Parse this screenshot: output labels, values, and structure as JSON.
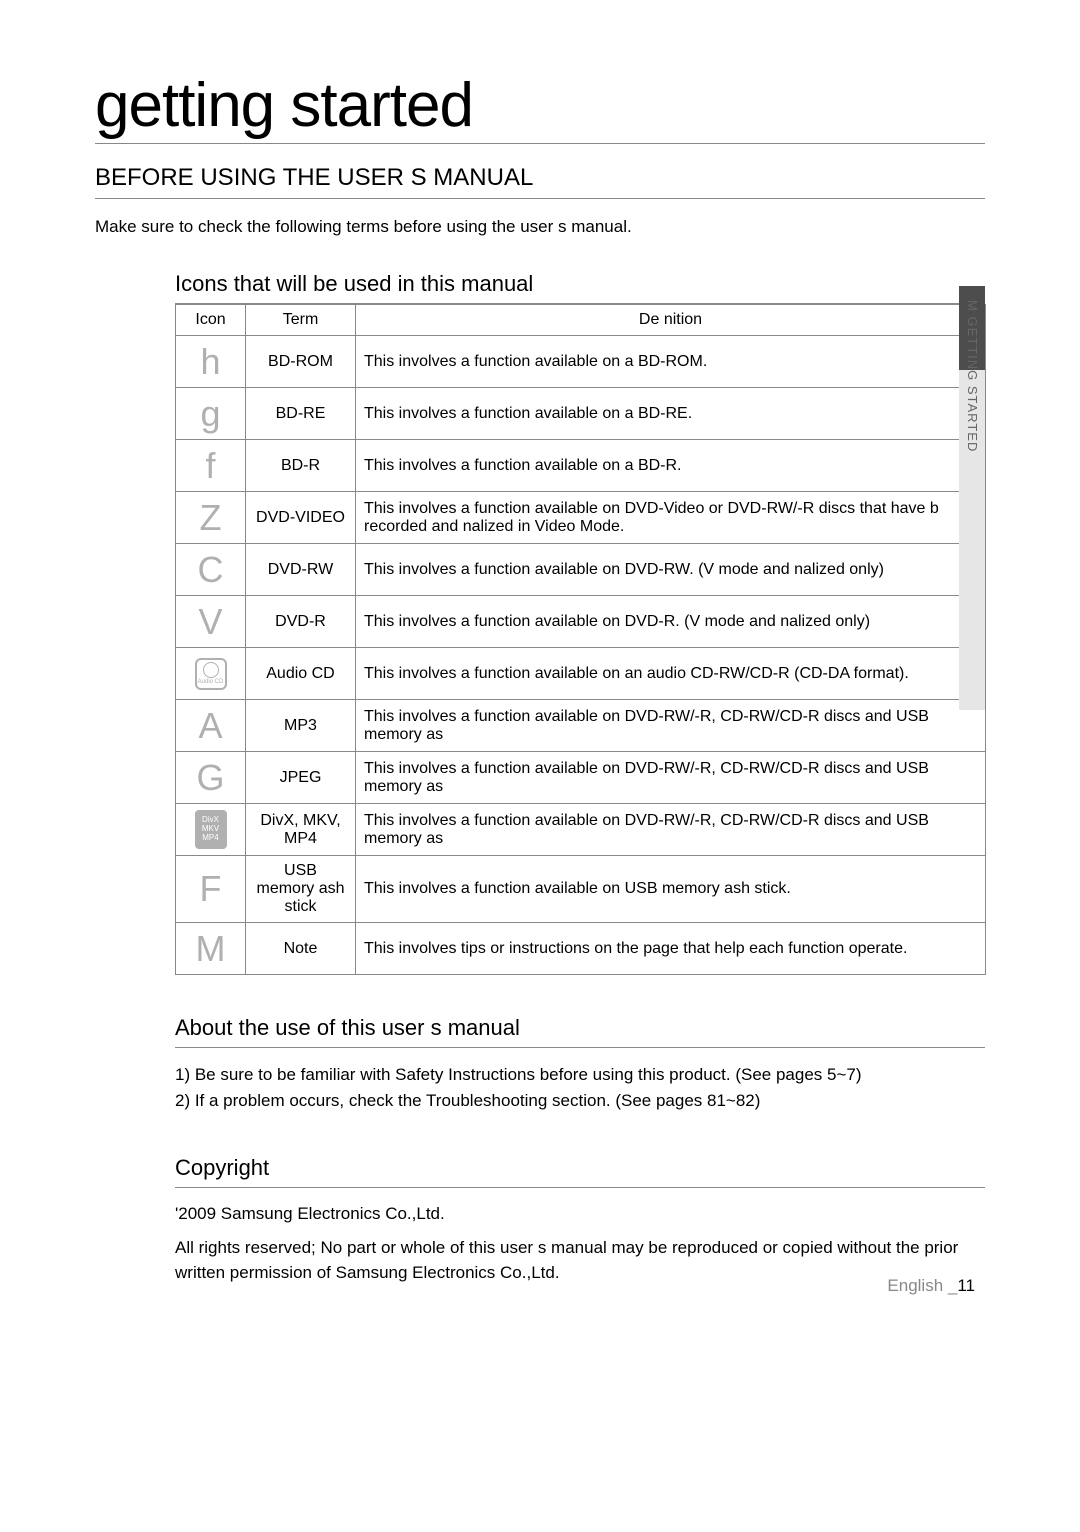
{
  "title": "getting started",
  "sectionTitle": "BEFORE USING THE USER S MANUAL",
  "intro": "Make sure to check the following terms before using the user s manual.",
  "iconsHeading": "Icons that will be used in this manual",
  "tableHeaders": {
    "icon": "Icon",
    "term": "Term",
    "definition": "De nition"
  },
  "rows": [
    {
      "glyph": "h",
      "term": "BD-ROM",
      "def": "This involves a function available on a BD-ROM."
    },
    {
      "glyph": "g",
      "term": "BD-RE",
      "def": "This involves a function available on a BD-RE."
    },
    {
      "glyph": "f",
      "term": "BD-R",
      "def": "This involves a function available on a BD-R."
    },
    {
      "glyph": "Z",
      "term": "DVD-VIDEO",
      "def": "This involves a function available on DVD-Video or DVD-RW/-R discs that have b recorded and  nalized in Video Mode."
    },
    {
      "glyph": "C",
      "term": "DVD-RW",
      "def": "This involves a function available on DVD-RW. (V mode and  nalized only)"
    },
    {
      "glyph": "V",
      "term": "DVD-R",
      "def": "This involves a function available on DVD-R. (V mode and  nalized only)"
    },
    {
      "glyph": "audio-cd",
      "term": "Audio CD",
      "def": "This involves a function available on an audio CD-RW/CD-R (CD-DA format)."
    },
    {
      "glyph": "A",
      "term": "MP3",
      "def": "This involves a function available on DVD-RW/-R, CD-RW/CD-R discs and USB memory  as"
    },
    {
      "glyph": "G",
      "term": "JPEG",
      "def": "This involves a function available on DVD-RW/-R, CD-RW/CD-R discs and USB memory  as"
    },
    {
      "glyph": "divx-badge",
      "term": "DivX, MKV, MP4",
      "def": "This involves a function available on DVD-RW/-R, CD-RW/CD-R discs and USB memory  as"
    },
    {
      "glyph": "F",
      "term": "USB memory ash stick",
      "def": "This involves a function available on USB memory  ash stick."
    },
    {
      "glyph": "M",
      "term": "Note",
      "def": "This involves tips or instructions on the page that help each function operate."
    }
  ],
  "aboutHeading": "About the use of this user s manual",
  "aboutItems": [
    "1)  Be sure to be familiar with Safety Instructions before using this product. (See pages 5~7)",
    "2)  If a problem occurs, check the Troubleshooting section. (See pages 81~82)"
  ],
  "copyrightHeading": "Copyright",
  "copyrightLines": [
    "'2009 Samsung Electronics Co.,Ltd.",
    "All rights reserved; No part or whole of this user s manual may be reproduced or copied without the prior written permission of Samsung Electronics Co.,Ltd."
  ],
  "sideTab": "GETTING STARTED",
  "sideTabBullet": "M",
  "footer": {
    "lang": "English _",
    "page": "11"
  }
}
